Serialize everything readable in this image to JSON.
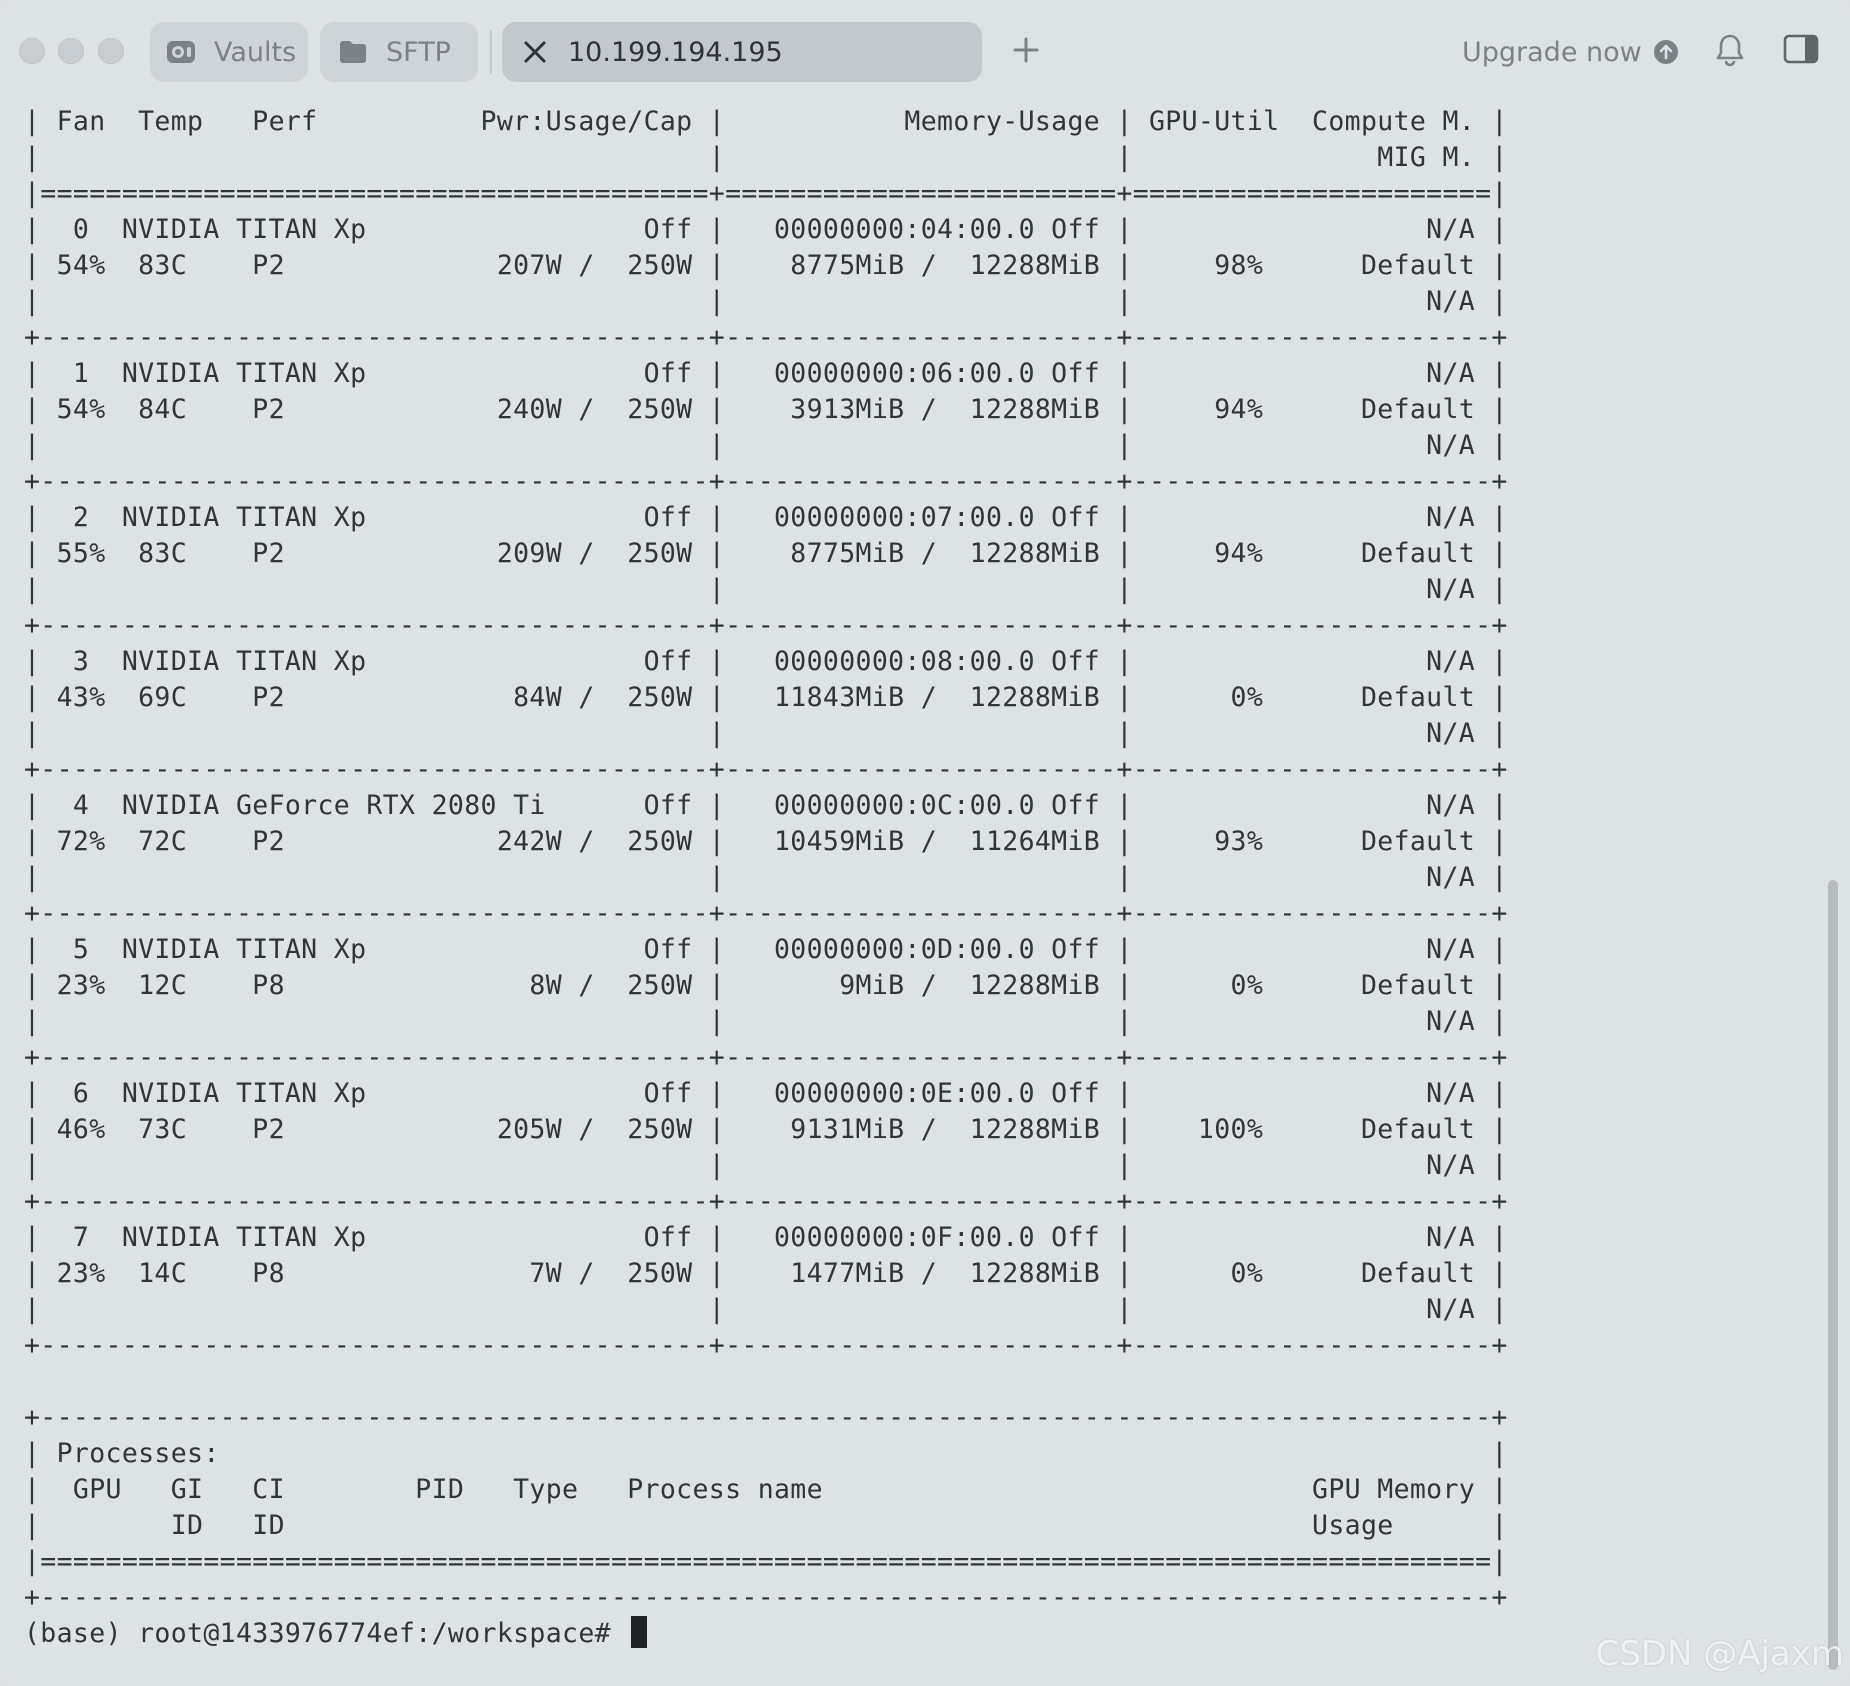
{
  "titlebar": {
    "tabs": [
      {
        "label": "Vaults",
        "icon": "vault-icon",
        "active": false
      },
      {
        "label": "SFTP",
        "icon": "folder-icon",
        "active": false
      },
      {
        "label": "10.199.194.195",
        "icon": "close-icon",
        "active": true
      }
    ],
    "new_tab_icon": "plus-icon",
    "upgrade_label": "Upgrade now",
    "upgrade_icon": "arrow-up-circle-icon",
    "notifications_icon": "bell-icon",
    "panel_toggle_icon": "sidebar-panel-icon"
  },
  "terminal": {
    "lines": [
      "| Fan  Temp   Perf          Pwr:Usage/Cap |           Memory-Usage | GPU-Util  Compute M. |",
      "|                                         |                        |               MIG M. |",
      "|=========================================+========================+======================|",
      "|  0  NVIDIA TITAN Xp                 Off |   00000000:04:00.0 Off |                  N/A |",
      "| 54%  83C    P2             207W /  250W |    8775MiB /  12288MiB |     98%      Default |",
      "|                                         |                        |                  N/A |",
      "+-----------------------------------------+------------------------+----------------------+",
      "|  1  NVIDIA TITAN Xp                 Off |   00000000:06:00.0 Off |                  N/A |",
      "| 54%  84C    P2             240W /  250W |    3913MiB /  12288MiB |     94%      Default |",
      "|                                         |                        |                  N/A |",
      "+-----------------------------------------+------------------------+----------------------+",
      "|  2  NVIDIA TITAN Xp                 Off |   00000000:07:00.0 Off |                  N/A |",
      "| 55%  83C    P2             209W /  250W |    8775MiB /  12288MiB |     94%      Default |",
      "|                                         |                        |                  N/A |",
      "+-----------------------------------------+------------------------+----------------------+",
      "|  3  NVIDIA TITAN Xp                 Off |   00000000:08:00.0 Off |                  N/A |",
      "| 43%  69C    P2              84W /  250W |   11843MiB /  12288MiB |      0%      Default |",
      "|                                         |                        |                  N/A |",
      "+-----------------------------------------+------------------------+----------------------+",
      "|  4  NVIDIA GeForce RTX 2080 Ti      Off |   00000000:0C:00.0 Off |                  N/A |",
      "| 72%  72C    P2             242W /  250W |   10459MiB /  11264MiB |     93%      Default |",
      "|                                         |                        |                  N/A |",
      "+-----------------------------------------+------------------------+----------------------+",
      "|  5  NVIDIA TITAN Xp                 Off |   00000000:0D:00.0 Off |                  N/A |",
      "| 23%  12C    P8               8W /  250W |       9MiB /  12288MiB |      0%      Default |",
      "|                                         |                        |                  N/A |",
      "+-----------------------------------------+------------------------+----------------------+",
      "|  6  NVIDIA TITAN Xp                 Off |   00000000:0E:00.0 Off |                  N/A |",
      "| 46%  73C    P2             205W /  250W |    9131MiB /  12288MiB |    100%      Default |",
      "|                                         |                        |                  N/A |",
      "+-----------------------------------------+------------------------+----------------------+",
      "|  7  NVIDIA TITAN Xp                 Off |   00000000:0F:00.0 Off |                  N/A |",
      "| 23%  14C    P8               7W /  250W |    1477MiB /  12288MiB |      0%      Default |",
      "|                                         |                        |                  N/A |",
      "+-----------------------------------------+------------------------+----------------------+",
      "",
      "+-----------------------------------------------------------------------------------------+",
      "| Processes:                                                                              |",
      "|  GPU   GI   CI        PID   Type   Process name                              GPU Memory |",
      "|        ID   ID                                                               Usage      |",
      "|=========================================================================================|",
      "+-----------------------------------------------------------------------------------------+"
    ],
    "prompt": "(base) root@1433976774ef:/workspace# "
  },
  "watermark": "CSDN @Ajaxm"
}
